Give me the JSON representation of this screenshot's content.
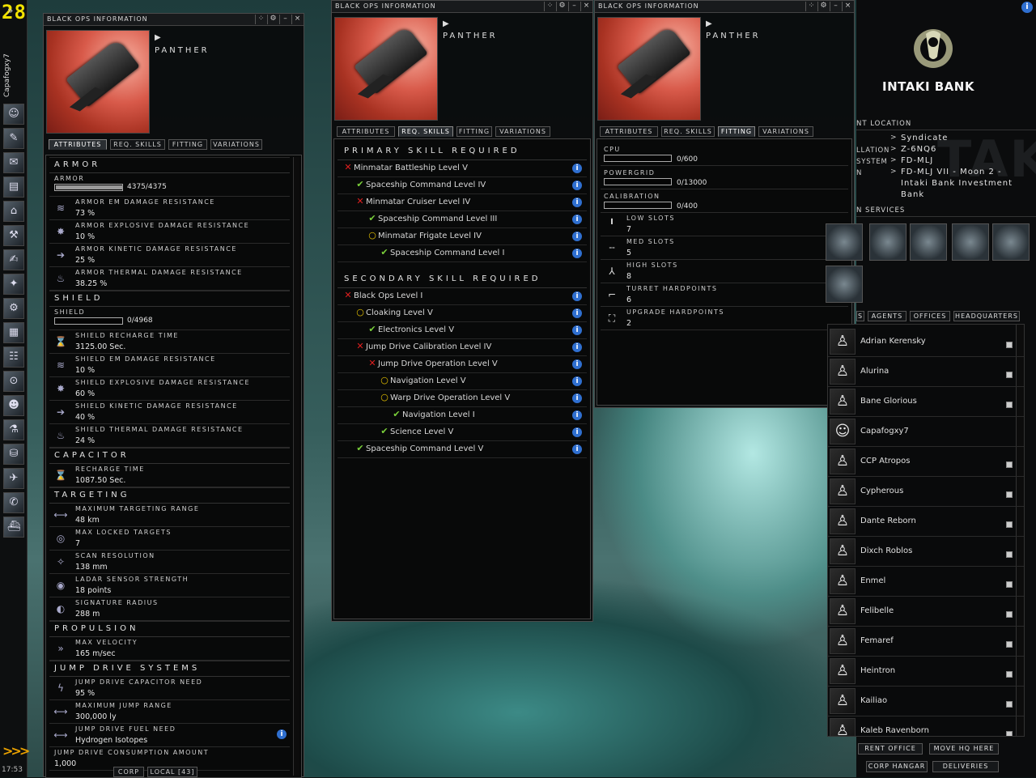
{
  "neocom": {
    "count": "28",
    "chevron": "»",
    "pilot": "Capafogxy7",
    "time": "17:53",
    "icons": [
      "character-sheet-icon",
      "skills-icon",
      "mail-icon",
      "notepad-icon",
      "market-icon",
      "industry-icon",
      "journal-icon",
      "map-icon",
      "fitting-icon",
      "assets-icon",
      "corporation-icon",
      "help-icon",
      "people-icon",
      "science-icon",
      "wallet-icon",
      "contracts-icon",
      "agents-icon",
      "ships-icon"
    ]
  },
  "win1": {
    "title": "BLACK OPS INFORMATION",
    "ship": "PANTHER",
    "tabs": [
      "ATTRIBUTES",
      "REQ. SKILLS",
      "FITTING",
      "VARIATIONS"
    ],
    "sections": {
      "armor": {
        "title": "ARMOR",
        "bar_label": "ARMOR",
        "bar_value": "4375/4375",
        "fill": 1.0,
        "rows": [
          {
            "label": "ARMOR EM DAMAGE RESISTANCE",
            "value": "73 %"
          },
          {
            "label": "ARMOR EXPLOSIVE DAMAGE RESISTANCE",
            "value": "10 %"
          },
          {
            "label": "ARMOR KINETIC DAMAGE RESISTANCE",
            "value": "25 %"
          },
          {
            "label": "ARMOR THERMAL DAMAGE RESISTANCE",
            "value": "38.25 %"
          }
        ]
      },
      "shield": {
        "title": "SHIELD",
        "bar_label": "SHIELD",
        "bar_value": "0/4968",
        "fill": 0.0,
        "rows": [
          {
            "label": "SHIELD RECHARGE TIME",
            "value": "3125.00 Sec."
          },
          {
            "label": "SHIELD EM DAMAGE RESISTANCE",
            "value": "10 %"
          },
          {
            "label": "SHIELD EXPLOSIVE DAMAGE RESISTANCE",
            "value": "60 %"
          },
          {
            "label": "SHIELD KINETIC DAMAGE RESISTANCE",
            "value": "40 %"
          },
          {
            "label": "SHIELD THERMAL DAMAGE RESISTANCE",
            "value": "24 %"
          }
        ]
      },
      "capacitor": {
        "title": "CAPACITOR",
        "rows": [
          {
            "label": "RECHARGE TIME",
            "value": "1087.50 Sec."
          }
        ]
      },
      "targeting": {
        "title": "TARGETING",
        "rows": [
          {
            "label": "MAXIMUM TARGETING RANGE",
            "value": "48 km"
          },
          {
            "label": "MAX LOCKED TARGETS",
            "value": "7"
          },
          {
            "label": "SCAN RESOLUTION",
            "value": "138 mm"
          },
          {
            "label": "LADAR SENSOR STRENGTH",
            "value": "18 points"
          },
          {
            "label": "SIGNATURE RADIUS",
            "value": "288 m"
          }
        ]
      },
      "propulsion": {
        "title": "PROPULSION",
        "rows": [
          {
            "label": "MAX VELOCITY",
            "value": "165 m/sec"
          }
        ]
      },
      "jump": {
        "title": "JUMP DRIVE SYSTEMS",
        "rows": [
          {
            "label": "JUMP DRIVE CAPACITOR NEED",
            "value": "95 %"
          },
          {
            "label": "MAXIMUM JUMP RANGE",
            "value": "300,000 ly"
          },
          {
            "label": "JUMP DRIVE FUEL NEED",
            "value": "Hydrogen Isotopes"
          }
        ],
        "last_label": "JUMP DRIVE CONSUMPTION AMOUNT",
        "last_value": "1,000"
      }
    },
    "chat_tabs": [
      "CORP",
      "LOCAL [43]"
    ]
  },
  "win2": {
    "title": "BLACK OPS INFORMATION",
    "ship": "PANTHER",
    "tabs": [
      "ATTRIBUTES",
      "REQ. SKILLS",
      "FITTING",
      "VARIATIONS"
    ],
    "primary_title": "PRIMARY SKILL REQUIRED",
    "primary": [
      {
        "s": "x",
        "lvl": 0,
        "label": "Minmatar Battleship Level V"
      },
      {
        "s": "ok",
        "lvl": 1,
        "label": "Spaceship Command Level IV"
      },
      {
        "s": "x",
        "lvl": 1,
        "label": "Minmatar Cruiser Level IV"
      },
      {
        "s": "ok",
        "lvl": 2,
        "label": "Spaceship Command Level III"
      },
      {
        "s": "o",
        "lvl": 2,
        "label": "Minmatar Frigate Level IV"
      },
      {
        "s": "ok",
        "lvl": 3,
        "label": "Spaceship Command Level I"
      }
    ],
    "secondary_title": "SECONDARY SKILL REQUIRED",
    "secondary": [
      {
        "s": "x",
        "lvl": 0,
        "label": "Black Ops Level I"
      },
      {
        "s": "o",
        "lvl": 1,
        "label": "Cloaking Level V"
      },
      {
        "s": "ok",
        "lvl": 2,
        "label": "Electronics Level V"
      },
      {
        "s": "x",
        "lvl": 1,
        "label": "Jump Drive Calibration Level IV"
      },
      {
        "s": "x",
        "lvl": 2,
        "label": "Jump Drive Operation Level V"
      },
      {
        "s": "o",
        "lvl": 3,
        "label": "Navigation Level V"
      },
      {
        "s": "o",
        "lvl": 3,
        "label": "Warp Drive Operation Level V"
      },
      {
        "s": "ok",
        "lvl": 4,
        "label": "Navigation Level I"
      },
      {
        "s": "ok",
        "lvl": 3,
        "label": "Science Level V"
      },
      {
        "s": "ok",
        "lvl": 1,
        "label": "Spaceship Command Level V"
      }
    ]
  },
  "win3": {
    "title": "BLACK OPS INFORMATION",
    "ship": "PANTHER",
    "tabs": [
      "ATTRIBUTES",
      "REQ. SKILLS",
      "FITTING",
      "VARIATIONS"
    ],
    "bars": [
      {
        "label": "CPU",
        "value": "0/600"
      },
      {
        "label": "POWERGRID",
        "value": "0/13000"
      },
      {
        "label": "CALIBRATION",
        "value": "0/400"
      }
    ],
    "slots": [
      {
        "icon": "low-slot-icon",
        "glyph": "╹",
        "label": "LOW SLOTS",
        "value": "7"
      },
      {
        "icon": "med-slot-icon",
        "glyph": "╌",
        "label": "MED SLOTS",
        "value": "5"
      },
      {
        "icon": "high-slot-icon",
        "glyph": "⅄",
        "label": "HIGH SLOTS",
        "value": "8"
      },
      {
        "icon": "turret-icon",
        "glyph": "⌐",
        "label": "TURRET HARDPOINTS",
        "value": "6"
      },
      {
        "icon": "upgrade-icon",
        "glyph": "⛶",
        "label": "UPGRADE HARDPOINTS",
        "value": "2"
      }
    ]
  },
  "corp": {
    "name": "INTAKI BANK",
    "location_header": "NT LOCATION",
    "loc_labels": [
      "LLATION",
      "SYSTEM",
      "N"
    ],
    "loc_values": [
      "Syndicate",
      "Z-6NQ6",
      "FD-MLJ",
      "FD-MLJ VII - Moon 2 -",
      "Intaki Bank Investment",
      "Bank"
    ],
    "services_header": "N SERVICES",
    "watermark": "TAK",
    "tabs": [
      "S",
      "AGENTS",
      "OFFICES",
      "HEADQUARTERS"
    ],
    "agents": [
      "Adrian Kerensky",
      "Alurina",
      "Bane Glorious",
      "Capafogxy7",
      "CCP Atropos",
      "Cypherous",
      "Dante Reborn",
      "Dixch Roblos",
      "Enmel",
      "Felibelle",
      "Femaref",
      "Heintron",
      "Kailiao",
      "Kaleb Ravenborn"
    ],
    "buttons": [
      "RENT OFFICE",
      "MOVE HQ HERE",
      "CORP HANGAR",
      "DELIVERIES"
    ]
  }
}
